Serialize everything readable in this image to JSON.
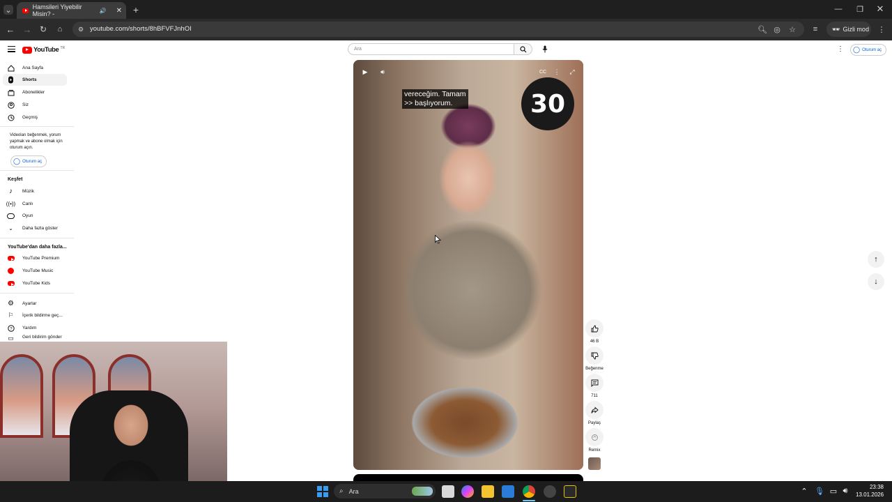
{
  "browser": {
    "tab_title": "Hamsileri Yiyebilir Misin? - ",
    "url": "youtube.com/shorts/8hBFVFJnhOI",
    "incognito_label": "Gizli mod"
  },
  "youtube": {
    "logo_text": "YouTube",
    "logo_region": "TR",
    "search_placeholder": "Ara",
    "signin_label": "Oturum aç",
    "sidebar": {
      "main": [
        {
          "label": "Ana Sayfa",
          "icon": "home-icon"
        },
        {
          "label": "Shorts",
          "icon": "shorts-icon",
          "active": true
        },
        {
          "label": "Abonelikler",
          "icon": "subscriptions-icon"
        },
        {
          "label": "Siz",
          "icon": "you-icon"
        },
        {
          "label": "Geçmiş",
          "icon": "history-icon"
        }
      ],
      "login_message": "Videoları beğenmek, yorum yapmak ve abone olmak için oturum açın.",
      "login_button": "Oturum aç",
      "explore_title": "Keşfet",
      "explore": [
        {
          "label": "Müzik",
          "icon": "music-icon"
        },
        {
          "label": "Canlı",
          "icon": "live-icon"
        },
        {
          "label": "Oyun",
          "icon": "gaming-icon"
        },
        {
          "label": "Daha fazla göster",
          "icon": "chevron-down-icon"
        }
      ],
      "more_title": "YouTube'dan daha fazla...",
      "more": [
        {
          "label": "YouTube Premium",
          "icon": "youtube-premium-icon"
        },
        {
          "label": "YouTube Music",
          "icon": "youtube-music-icon"
        },
        {
          "label": "YouTube Kids",
          "icon": "youtube-kids-icon"
        }
      ],
      "settings": [
        {
          "label": "Ayarlar",
          "icon": "gear-icon"
        },
        {
          "label": "İçerik bildirme geç...",
          "icon": "flag-icon"
        },
        {
          "label": "Yardım",
          "icon": "help-icon"
        },
        {
          "label": "Geri bildirim gönder",
          "icon": "feedback-icon"
        }
      ]
    },
    "short": {
      "subtitle_line1": "vereceğim. Tamam",
      "subtitle_line2": ">> başlıyorum.",
      "timer": "30",
      "actions": {
        "like": "46 B",
        "dislike": "Beğenme",
        "comments": "711",
        "share": "Paylaş",
        "remix": "Remix"
      }
    }
  },
  "taskbar": {
    "search_label": "Ara",
    "time": "23:38",
    "date": "13.01.2026"
  }
}
